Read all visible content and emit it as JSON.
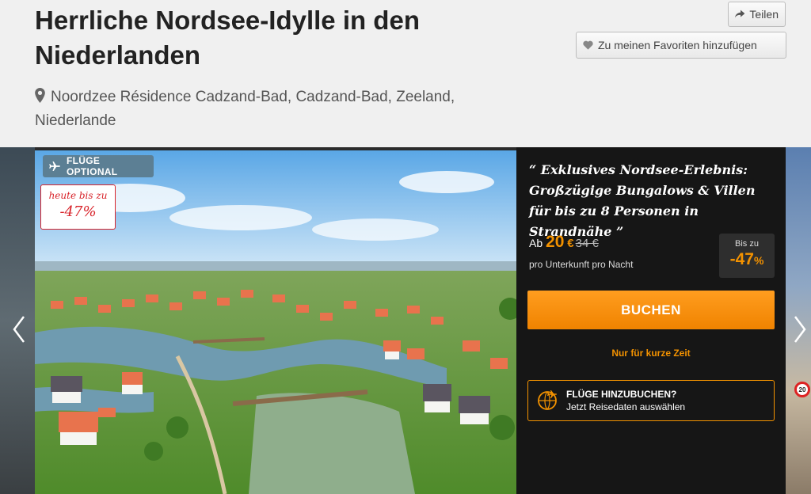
{
  "listing": {
    "title": "Herrliche Nordsee-Idylle in den Niederlanden",
    "location": "Noordzee Résidence Cadzand-Bad, Cadzand-Bad, Zeeland, Niederlande"
  },
  "actions": {
    "share_label": "Teilen",
    "favorite_label": "Zu meinen Favoriten hinzufügen"
  },
  "gallery": {
    "flights_badge": "FLÜGE OPTIONAL",
    "discount_badge_line1": "heute bis zu",
    "discount_badge_line2": "-47%",
    "road_sign": "20"
  },
  "offer": {
    "quote": "“ Exklusives Nordsee-Erlebnis: Großzügige Bungalows & Villen für bis zu 8 Personen in Strandnähe ”",
    "price_prefix": "Ab",
    "price": "20",
    "currency": "€",
    "old_price": "34 €",
    "per_night": "pro Unterkunft pro Nacht",
    "discount_label": "Bis zu",
    "discount_value": "-47",
    "discount_unit": "%",
    "book_label": "BUCHEN",
    "limited_time": "Nur für kurze Zeit",
    "add_flights_title": "FLÜGE HINZUBUCHEN?",
    "add_flights_sub": "Jetzt Reisedaten auswählen"
  },
  "icons": {
    "location": "map-pin-icon",
    "share": "share-arrow-icon",
    "favorite": "heart-icon",
    "plane": "plane-icon",
    "prev": "chevron-left-icon",
    "next": "chevron-right-icon"
  },
  "colors": {
    "accent": "#f39200",
    "discount_red": "#d8232a",
    "panel_bg": "#161616",
    "flights_badge_bg": "#5c7f94"
  }
}
